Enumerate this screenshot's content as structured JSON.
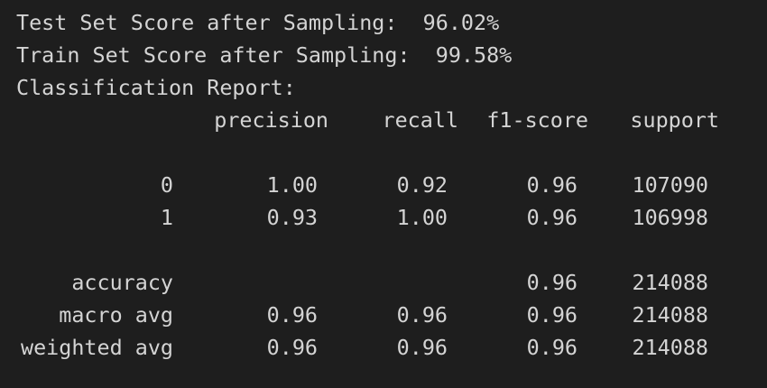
{
  "scores": {
    "test_label": "Test Set Score after Sampling:",
    "test_value": "96.02%",
    "train_label": "Train Set Score after Sampling:",
    "train_value": "99.58%"
  },
  "report": {
    "title": "Classification Report:",
    "headers": {
      "precision": "precision",
      "recall": "recall",
      "f1": "f1-score",
      "support": "support"
    },
    "class_rows": [
      {
        "label": "0",
        "precision": "1.00",
        "recall": "0.92",
        "f1": "0.96",
        "support": "107090"
      },
      {
        "label": "1",
        "precision": "0.93",
        "recall": "1.00",
        "f1": "0.96",
        "support": "106998"
      }
    ],
    "accuracy": {
      "label": "accuracy",
      "f1": "0.96",
      "support": "214088"
    },
    "summary_rows": [
      {
        "label": "macro avg",
        "precision": "0.96",
        "recall": "0.96",
        "f1": "0.96",
        "support": "214088"
      },
      {
        "label": "weighted avg",
        "precision": "0.96",
        "recall": "0.96",
        "f1": "0.96",
        "support": "214088"
      }
    ]
  }
}
